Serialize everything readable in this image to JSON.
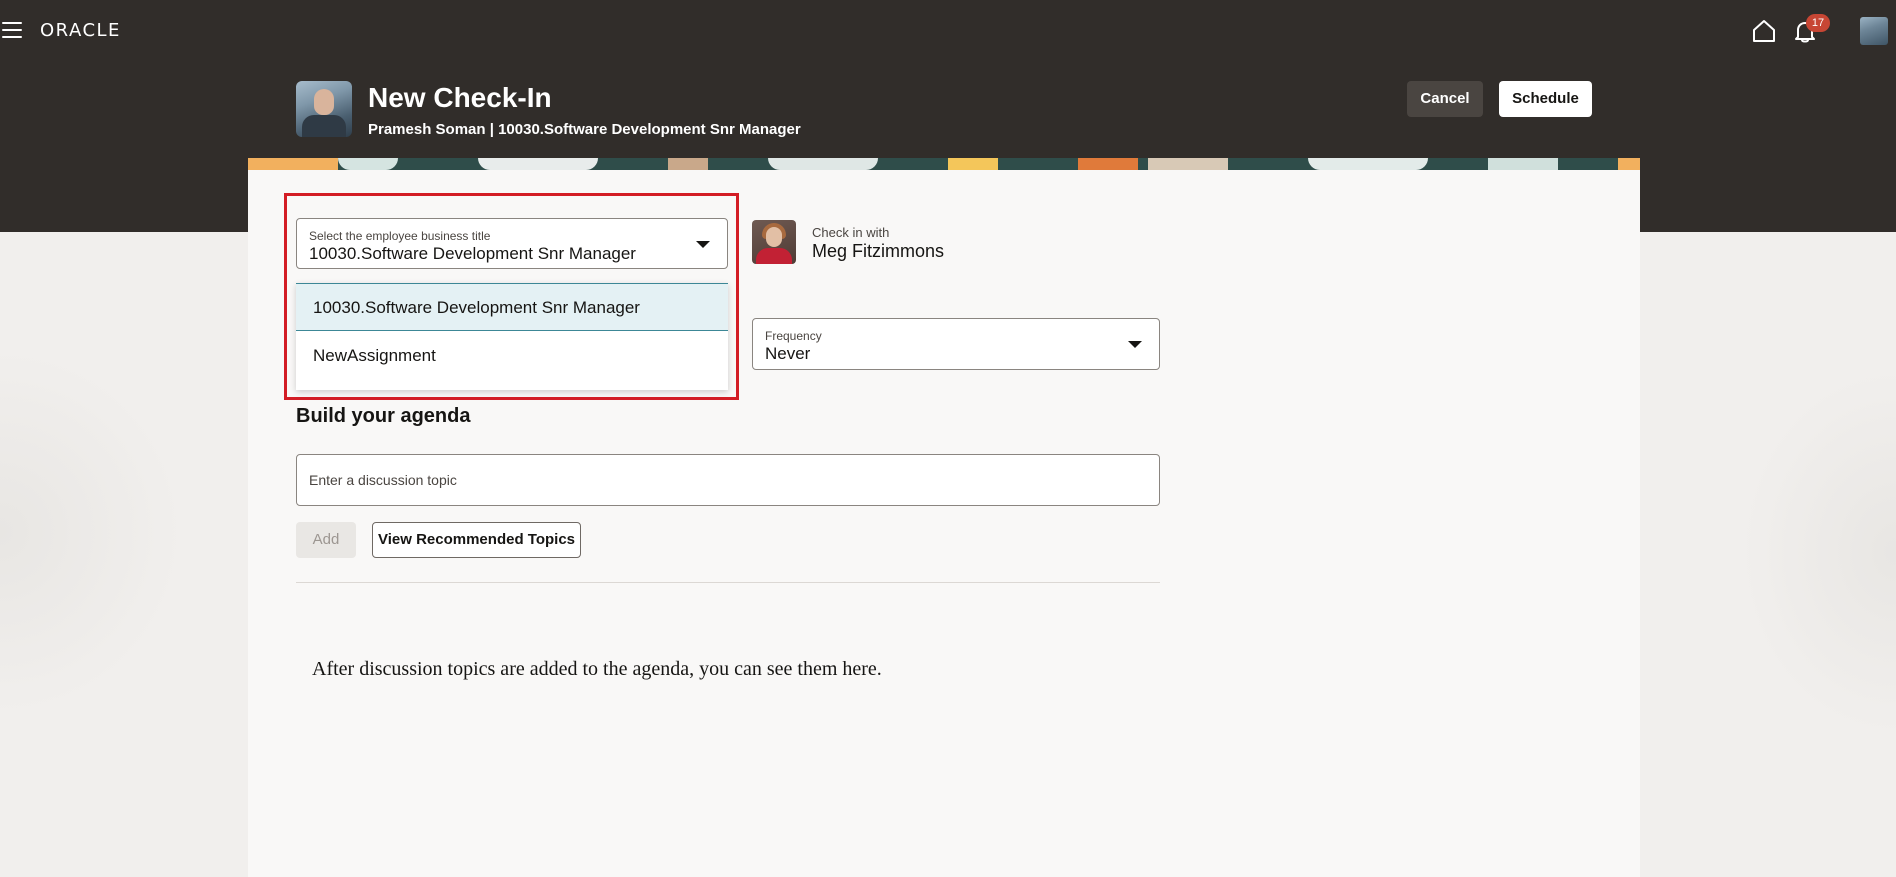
{
  "app": {
    "logo": "ORACLE",
    "notification_count": "17"
  },
  "header": {
    "title": "New Check-In",
    "subtitle": "Pramesh Soman | 10030.Software Development Snr Manager",
    "cancel_label": "Cancel",
    "schedule_label": "Schedule"
  },
  "business_title": {
    "label": "Select the employee business title",
    "value": "10030.Software Development Snr Manager",
    "options": [
      "10030.Software Development Snr Manager",
      "NewAssignment"
    ]
  },
  "check_in_with": {
    "label": "Check in with",
    "name": "Meg Fitzimmons"
  },
  "frequency": {
    "label": "Frequency",
    "value": "Never"
  },
  "agenda": {
    "title": "Build your agenda",
    "topic_placeholder": "Enter a discussion topic",
    "add_label": "Add",
    "recommended_label": "View Recommended Topics",
    "empty_message": "After discussion topics are added to the agenda, you can see them here."
  },
  "colors": {
    "header_bg": "#312d2a",
    "highlight_border": "#d31d25",
    "selected_option_bg": "#e4f1f4",
    "badge": "#c74634"
  }
}
